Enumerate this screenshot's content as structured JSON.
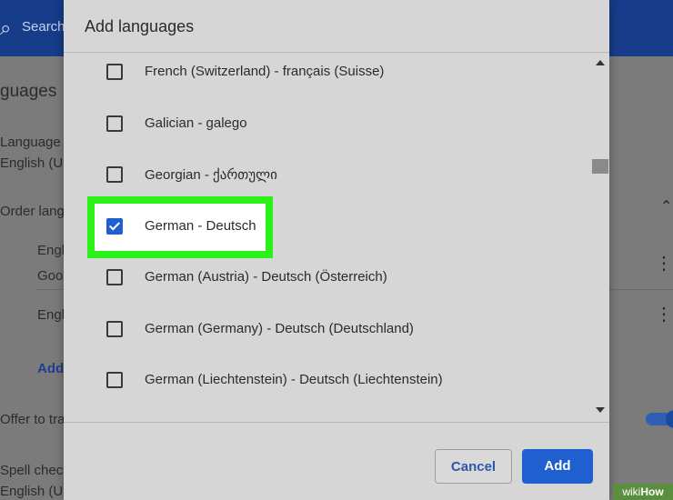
{
  "background": {
    "search_placeholder": "Search",
    "section_title": "guages",
    "language_label": "Language",
    "language_value": "English (Ur",
    "order_label": "Order langu",
    "order_items": [
      "Engl",
      "Goo",
      "Engl"
    ],
    "add_link": "Add",
    "offer_label": "Offer to tra",
    "spell_label": "Spell check",
    "spell_value": "English (Ur"
  },
  "dialog": {
    "title": "Add languages",
    "items": [
      {
        "label": "French (Switzerland) - français (Suisse)",
        "checked": false
      },
      {
        "label": "Galician - galego",
        "checked": false
      },
      {
        "label": "Georgian - ქართული",
        "checked": false
      },
      {
        "label": "German - Deutsch",
        "checked": true
      },
      {
        "label": "German (Austria) - Deutsch (Österreich)",
        "checked": false
      },
      {
        "label": "German (Germany) - Deutsch (Deutschland)",
        "checked": false
      },
      {
        "label": "German (Liechtenstein) - Deutsch (Liechtenstein)",
        "checked": false
      }
    ],
    "cancel_label": "Cancel",
    "add_label": "Add"
  },
  "colors": {
    "accent": "#1f5fd0",
    "highlight": "#2cf01a",
    "topbar": "#173c8a"
  },
  "icons": {
    "search": "search-icon",
    "more": "more-vert-icon",
    "chevron": "chevron-up-icon",
    "check": "checkmark-icon"
  },
  "watermark": {
    "prefix": "wiki",
    "suffix": "How"
  }
}
